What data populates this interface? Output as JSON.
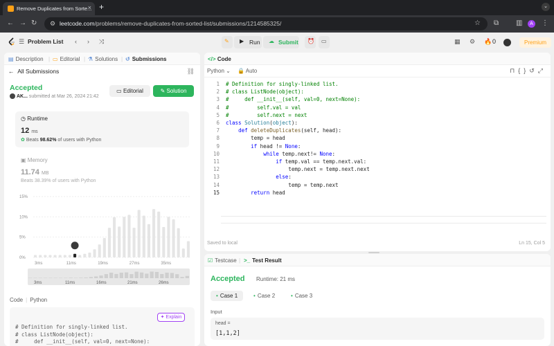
{
  "browser": {
    "tab_title": "Remove Duplicates from Sorte...",
    "tab_close": "×",
    "new_tab": "+",
    "url_host": "leetcode.com",
    "url_path": "/problems/remove-duplicates-from-sorted-list/submissions/1214585325/",
    "profile_initial": "A"
  },
  "header": {
    "problem_list": "Problem List",
    "run": "Run",
    "submit": "Submit",
    "notifications": "0",
    "premium": "Premium"
  },
  "left_tabs": [
    "Description",
    "Editorial",
    "Solutions",
    "Submissions"
  ],
  "submission": {
    "back": "All Submissions",
    "status": "Accepted",
    "user": "AK...",
    "submitted_at": "submitted at Mar 26, 2024 21:42",
    "editorial_btn": "Editorial",
    "solution_btn": "Solution"
  },
  "runtime": {
    "title": "Runtime",
    "value": "12",
    "unit": "ms",
    "beats_label": "Beats",
    "beats_pct": "98.62%",
    "beats_suffix": "of users with Python"
  },
  "memory": {
    "title": "Memory",
    "value": "11.74",
    "unit": "MB",
    "beats": "Beats 38.39% of users with Python"
  },
  "chart_data": {
    "type": "bar",
    "yticks": [
      "15%",
      "10%",
      "5%",
      "0%"
    ],
    "ylim": [
      0,
      15
    ],
    "xticks": [
      "3ms",
      "11ms",
      "19ms",
      "27ms",
      "35ms"
    ],
    "overview_ticks": [
      "3ms",
      "11ms",
      "16ms",
      "21ms",
      "26ms"
    ],
    "values": [
      0.6,
      0.6,
      0.6,
      0.6,
      0.6,
      0.6,
      0.6,
      0.6,
      0.9,
      0.6,
      0.9,
      1.2,
      2.0,
      3.2,
      4.8,
      7.3,
      9.9,
      7.6,
      10.0,
      10.5,
      7.3,
      11.7,
      10.3,
      8.2,
      11.9,
      11.3,
      7.5,
      10.0,
      9.4,
      7.2,
      2.2,
      4.0
    ],
    "highlight_index": 8,
    "bar_color": "#e5e5e5",
    "highlight_color": "#262626"
  },
  "code_section": {
    "tab_code": "Code",
    "tab_lang": "Python",
    "explain": "Explain",
    "snippet": "# Definition for singly-linked list.\n# class ListNode(object):\n#     def __init__(self, val=0, next=None):"
  },
  "editor": {
    "title": "Code",
    "language": "Python",
    "mode": "Auto",
    "lines": [
      "# Definition for singly-linked list.",
      "# class ListNode(object):",
      "#     def __init__(self, val=0, next=None):",
      "#         self.val = val",
      "#         self.next = next",
      "class Solution(object):",
      "    def deleteDuplicates(self, head):",
      "        temp = head",
      "        if head != None:",
      "            while temp.next!= None:",
      "                if temp.val == temp.next.val:",
      "                    temp.next = temp.next.next",
      "                else:",
      "                    temp = temp.next",
      "        return head"
    ],
    "saved": "Saved to local",
    "cursor": "Ln 15, Col 5"
  },
  "test": {
    "tab_testcase": "Testcase",
    "tab_result": "Test Result",
    "status": "Accepted",
    "runtime": "Runtime: 21 ms",
    "cases": [
      "Case 1",
      "Case 2",
      "Case 3"
    ],
    "input_label": "Input",
    "input_name": "head =",
    "input_value": "[1,1,2]"
  },
  "colors": {
    "accent_green": "#2db55d",
    "brand_orange": "#ffa116",
    "explain_purple": "#a142f4"
  }
}
